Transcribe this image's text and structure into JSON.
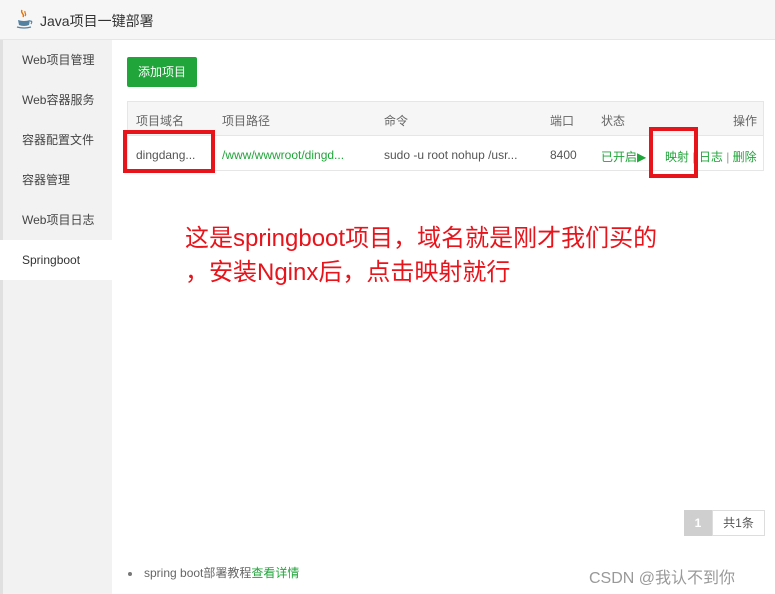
{
  "window": {
    "title": "Java项目一键部署"
  },
  "sidebar": {
    "items": [
      {
        "label": "Web项目管理"
      },
      {
        "label": "Web容器服务"
      },
      {
        "label": "容器配置文件"
      },
      {
        "label": "容器管理"
      },
      {
        "label": "Web项目日志"
      },
      {
        "label": "Springboot",
        "active": true
      }
    ]
  },
  "toolbar": {
    "add_label": "添加项目"
  },
  "table": {
    "headers": [
      "项目域名",
      "项目路径",
      "命令",
      "端口",
      "状态",
      "操作"
    ],
    "rows": [
      {
        "domain": "dingdang...",
        "path": "/www/wwwroot/dingd...",
        "command": "sudo -u root nohup /usr...",
        "port": "8400",
        "status": "已开启",
        "status_icon": "play-icon",
        "actions": {
          "map": "映射",
          "log": "日志",
          "delete": "删除",
          "separator": "|"
        }
      }
    ]
  },
  "annotation": {
    "line1": "这是springboot项目，域名就是刚才我们买的",
    "line2": "，安装Nginx后，点击映射就行"
  },
  "pagination": {
    "current": "1",
    "total": "共1条"
  },
  "tips": {
    "text": "spring boot部署教程",
    "link": "查看详情"
  },
  "watermark": "CSDN @我认不到你",
  "colors": {
    "accent": "#20a53a",
    "annotation": "#e8141c"
  }
}
